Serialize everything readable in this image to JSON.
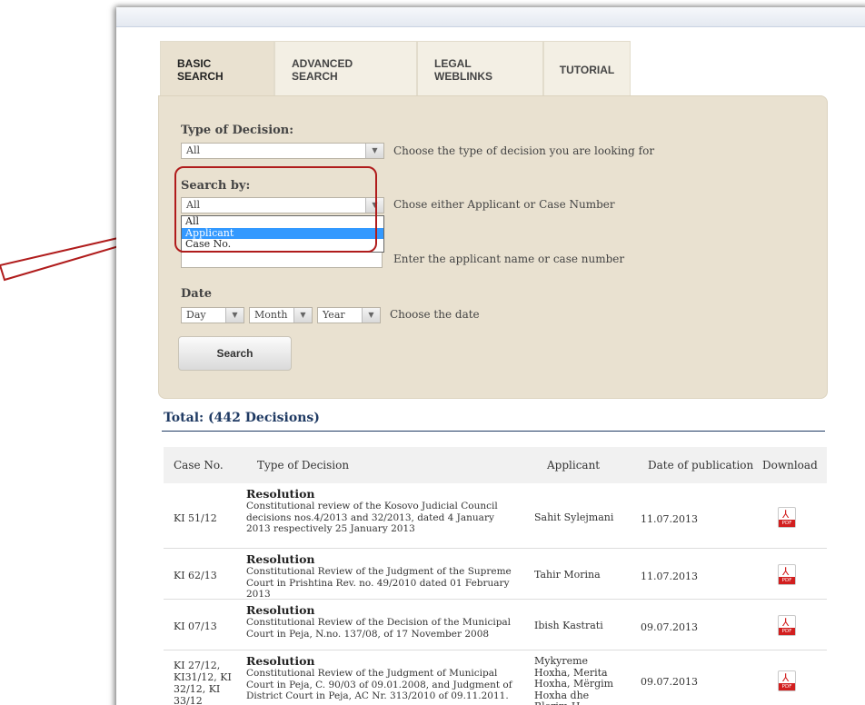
{
  "tabs": [
    {
      "label": "BASIC SEARCH"
    },
    {
      "label": "ADVANCED SEARCH"
    },
    {
      "label": "LEGAL WEBLINKS"
    },
    {
      "label": "TUTORIAL"
    }
  ],
  "form": {
    "type_of_decision": {
      "label": "Type of Decision:",
      "value": "All",
      "hint": "Choose the type of decision you are looking for"
    },
    "search_by": {
      "label": "Search by:",
      "value": "All",
      "hint": "Chose either Applicant or Case Number",
      "options": [
        "All",
        "Applicant",
        "Case No."
      ],
      "highlighted_option": "Applicant"
    },
    "query": {
      "value": "",
      "hint": "Enter the applicant name or case number"
    },
    "date": {
      "label": "Date",
      "day": "Day",
      "month": "Month",
      "year": "Year",
      "hint": "Choose the date"
    },
    "search_button": "Search"
  },
  "results": {
    "total": "Total: (442 Decisions)",
    "columns": [
      "Case No.",
      "Type of Decision",
      "Applicant",
      "Date of publication",
      "Download"
    ],
    "rows": [
      {
        "case_no": "KI 51/12",
        "type": "Resolution",
        "description": "Constitutional review of the Kosovo Judicial Council decisions nos.4/2013 and 32/2013, dated 4 January 2013 respectively 25 January 2013",
        "applicant": "Sahit Sylejmani",
        "date": "11.07.2013"
      },
      {
        "case_no": "KI 62/13",
        "type": "Resolution",
        "description": "Constitutional Review of the Judgment of the Supreme Court in Prishtina Rev. no. 49/2010 dated 01 February 2013",
        "applicant": "Tahir Morina",
        "date": "11.07.2013"
      },
      {
        "case_no": "KI 07/13",
        "type": "Resolution",
        "description": "Constitutional Review of the Decision of the Municipal Court in Peja, N.no. 137/08, of 17 November 2008",
        "applicant": "Ibish Kastrati",
        "date": "09.07.2013"
      },
      {
        "case_no": "KI 27/12, KI31/12, KI 32/12, KI 33/12",
        "type": "Resolution",
        "description": "Constitutional Review of the Judgment of Municipal Court in Peja, C. 90/03 of 09.01.2008, and Judgment of District Court in Peja, AC Nr. 313/2010 of 09.11.2011.",
        "applicant": "Mykyreme Hoxha, Merita Hoxha, Mërgim Hoxha dhe Blerim H",
        "date": "09.07.2013"
      }
    ],
    "download_icon": "pdf-icon",
    "download_tag": "PDF"
  },
  "colors": {
    "panel": "#e9e1d0",
    "accent": "#1f3a63",
    "annotation": "#b01c1c",
    "selected": "#3399ff"
  }
}
